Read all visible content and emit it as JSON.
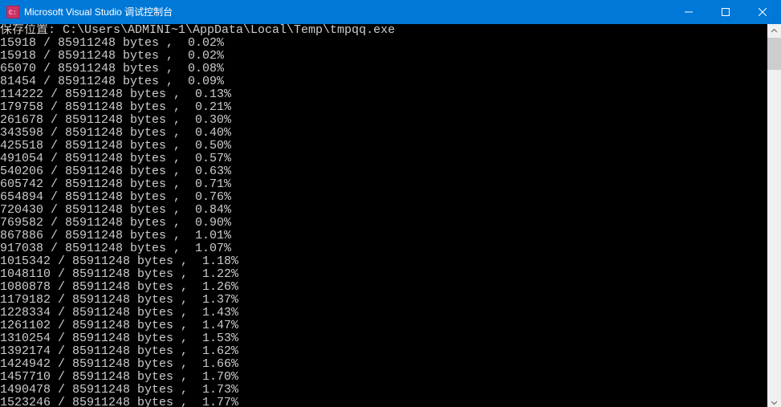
{
  "titlebar": {
    "title": "Microsoft Visual Studio 调试控制台"
  },
  "console": {
    "header_label": "保存位置:",
    "header_path": "C:\\Users\\ADMINI~1\\AppData\\Local\\Temp\\tmpqq.exe",
    "total_bytes": 85911248,
    "bytes_unit": "bytes",
    "lines": [
      {
        "downloaded": 15918,
        "percent": "0.02%"
      },
      {
        "downloaded": 15918,
        "percent": "0.02%"
      },
      {
        "downloaded": 65070,
        "percent": "0.08%"
      },
      {
        "downloaded": 81454,
        "percent": "0.09%"
      },
      {
        "downloaded": 114222,
        "percent": "0.13%"
      },
      {
        "downloaded": 179758,
        "percent": "0.21%"
      },
      {
        "downloaded": 261678,
        "percent": "0.30%"
      },
      {
        "downloaded": 343598,
        "percent": "0.40%"
      },
      {
        "downloaded": 425518,
        "percent": "0.50%"
      },
      {
        "downloaded": 491054,
        "percent": "0.57%"
      },
      {
        "downloaded": 540206,
        "percent": "0.63%"
      },
      {
        "downloaded": 605742,
        "percent": "0.71%"
      },
      {
        "downloaded": 654894,
        "percent": "0.76%"
      },
      {
        "downloaded": 720430,
        "percent": "0.84%"
      },
      {
        "downloaded": 769582,
        "percent": "0.90%"
      },
      {
        "downloaded": 867886,
        "percent": "1.01%"
      },
      {
        "downloaded": 917038,
        "percent": "1.07%"
      },
      {
        "downloaded": 1015342,
        "percent": "1.18%"
      },
      {
        "downloaded": 1048110,
        "percent": "1.22%"
      },
      {
        "downloaded": 1080878,
        "percent": "1.26%"
      },
      {
        "downloaded": 1179182,
        "percent": "1.37%"
      },
      {
        "downloaded": 1228334,
        "percent": "1.43%"
      },
      {
        "downloaded": 1261102,
        "percent": "1.47%"
      },
      {
        "downloaded": 1310254,
        "percent": "1.53%"
      },
      {
        "downloaded": 1392174,
        "percent": "1.62%"
      },
      {
        "downloaded": 1424942,
        "percent": "1.66%"
      },
      {
        "downloaded": 1457710,
        "percent": "1.70%"
      },
      {
        "downloaded": 1490478,
        "percent": "1.73%"
      },
      {
        "downloaded": 1523246,
        "percent": "1.77%"
      }
    ]
  }
}
